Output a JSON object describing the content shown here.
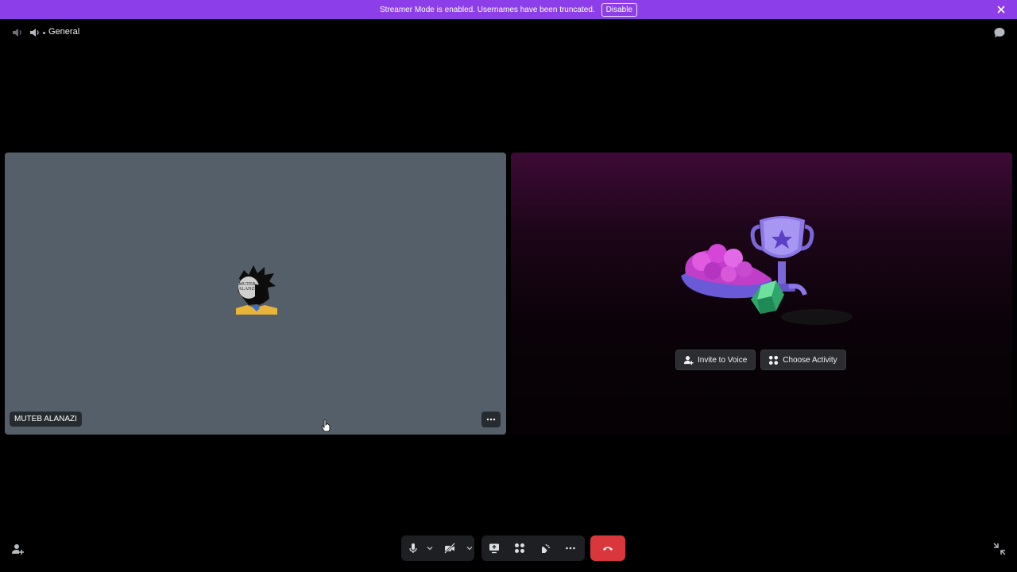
{
  "banner": {
    "message": "Streamer Mode is enabled. Usernames have been truncated.",
    "disable_label": "Disable",
    "background": "#8c3fe8"
  },
  "header": {
    "channel_name": "General",
    "icons": [
      "speaker-icon",
      "volume-icon",
      "chat-icon"
    ]
  },
  "user_tile": {
    "name": "MUTEB ALANAZI",
    "avatar_text": "MUTEB ALANAZI",
    "background": "#555f69"
  },
  "activity_tile": {
    "invite_label": "Invite to Voice",
    "choose_label": "Choose Activity"
  },
  "controls": {
    "icons": [
      "microphone-icon",
      "camera-off-icon",
      "screen-share-icon",
      "activities-icon",
      "soundboard-icon",
      "more-icon",
      "hang-up-icon"
    ],
    "hangup_color": "#da373c"
  }
}
